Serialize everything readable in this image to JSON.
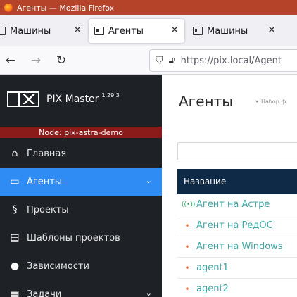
{
  "window": {
    "title": "Агенты — Mozilla Firefox"
  },
  "tabs": [
    {
      "label": "Машины",
      "active": false
    },
    {
      "label": "Агенты",
      "active": true
    },
    {
      "label": "Машины",
      "active": false
    }
  ],
  "nav": {
    "url": "https://pix.local/Agent"
  },
  "sidebar": {
    "brand": "PIX Master",
    "version": "1.29.3",
    "node": "Node: pix-astra-demo",
    "items": [
      {
        "label": "Главная",
        "icon": "home-icon"
      },
      {
        "label": "Агенты",
        "icon": "monitor-icon"
      },
      {
        "label": "Проекты",
        "icon": "projects-icon"
      },
      {
        "label": "Шаблоны проектов",
        "icon": "template-icon"
      },
      {
        "label": "Зависимости",
        "icon": "dependencies-icon"
      },
      {
        "label": "Задачи",
        "icon": "tasks-icon"
      }
    ]
  },
  "main": {
    "title": "Агенты",
    "filter_label": "Набор ф",
    "table": {
      "column": "Название",
      "rows": [
        {
          "name": "Агент на Астре",
          "status": "online"
        },
        {
          "name": "Агент на РедОС",
          "status": "offline"
        },
        {
          "name": "Агент на Windows",
          "status": "offline"
        },
        {
          "name": "agent1",
          "status": "offline"
        },
        {
          "name": "agent2",
          "status": "offline"
        }
      ]
    }
  },
  "colors": {
    "titlebar": "#b4432a",
    "sidebar_bg": "#1e2125",
    "active_item": "#2f8cf5",
    "node_badge": "#8b1a1a",
    "table_header": "#0f2a47",
    "link": "#3ba7a5",
    "status_online": "#27ae60",
    "status_offline": "#e57347"
  }
}
